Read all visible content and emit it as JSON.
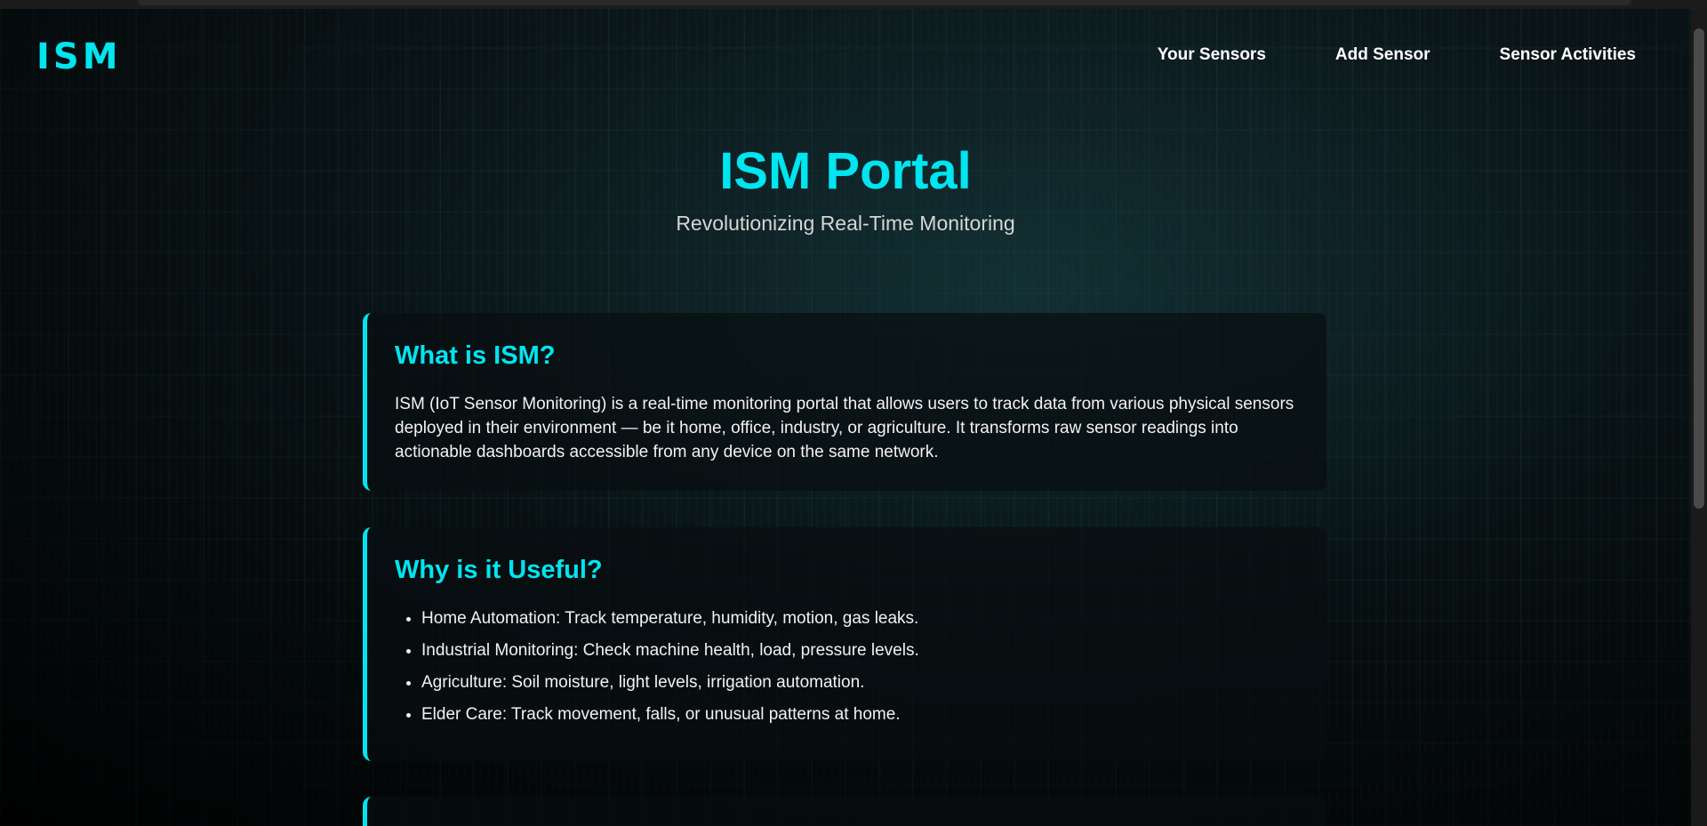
{
  "brand": {
    "logo": "ISM",
    "accent_color": "#00e5f0"
  },
  "nav": {
    "links": [
      "Your Sensors",
      "Add Sensor",
      "Sensor Activities"
    ]
  },
  "hero": {
    "title": "ISM Portal",
    "subtitle": "Revolutionizing Real-Time Monitoring"
  },
  "sections": [
    {
      "title": "What is ISM?",
      "text": "ISM (IoT Sensor Monitoring) is a real-time monitoring portal that allows users to track data from various physical sensors deployed in their environment — be it home, office, industry, or agriculture. It transforms raw sensor readings into actionable dashboards accessible from any device on the same network."
    },
    {
      "title": "Why is it Useful?",
      "items": [
        "Home Automation: Track temperature, humidity, motion, gas leaks.",
        "Industrial Monitoring: Check machine health, load, pressure levels.",
        "Agriculture: Soil moisture, light levels, irrigation automation.",
        "Elder Care: Track movement, falls, or unusual patterns at home."
      ]
    }
  ]
}
